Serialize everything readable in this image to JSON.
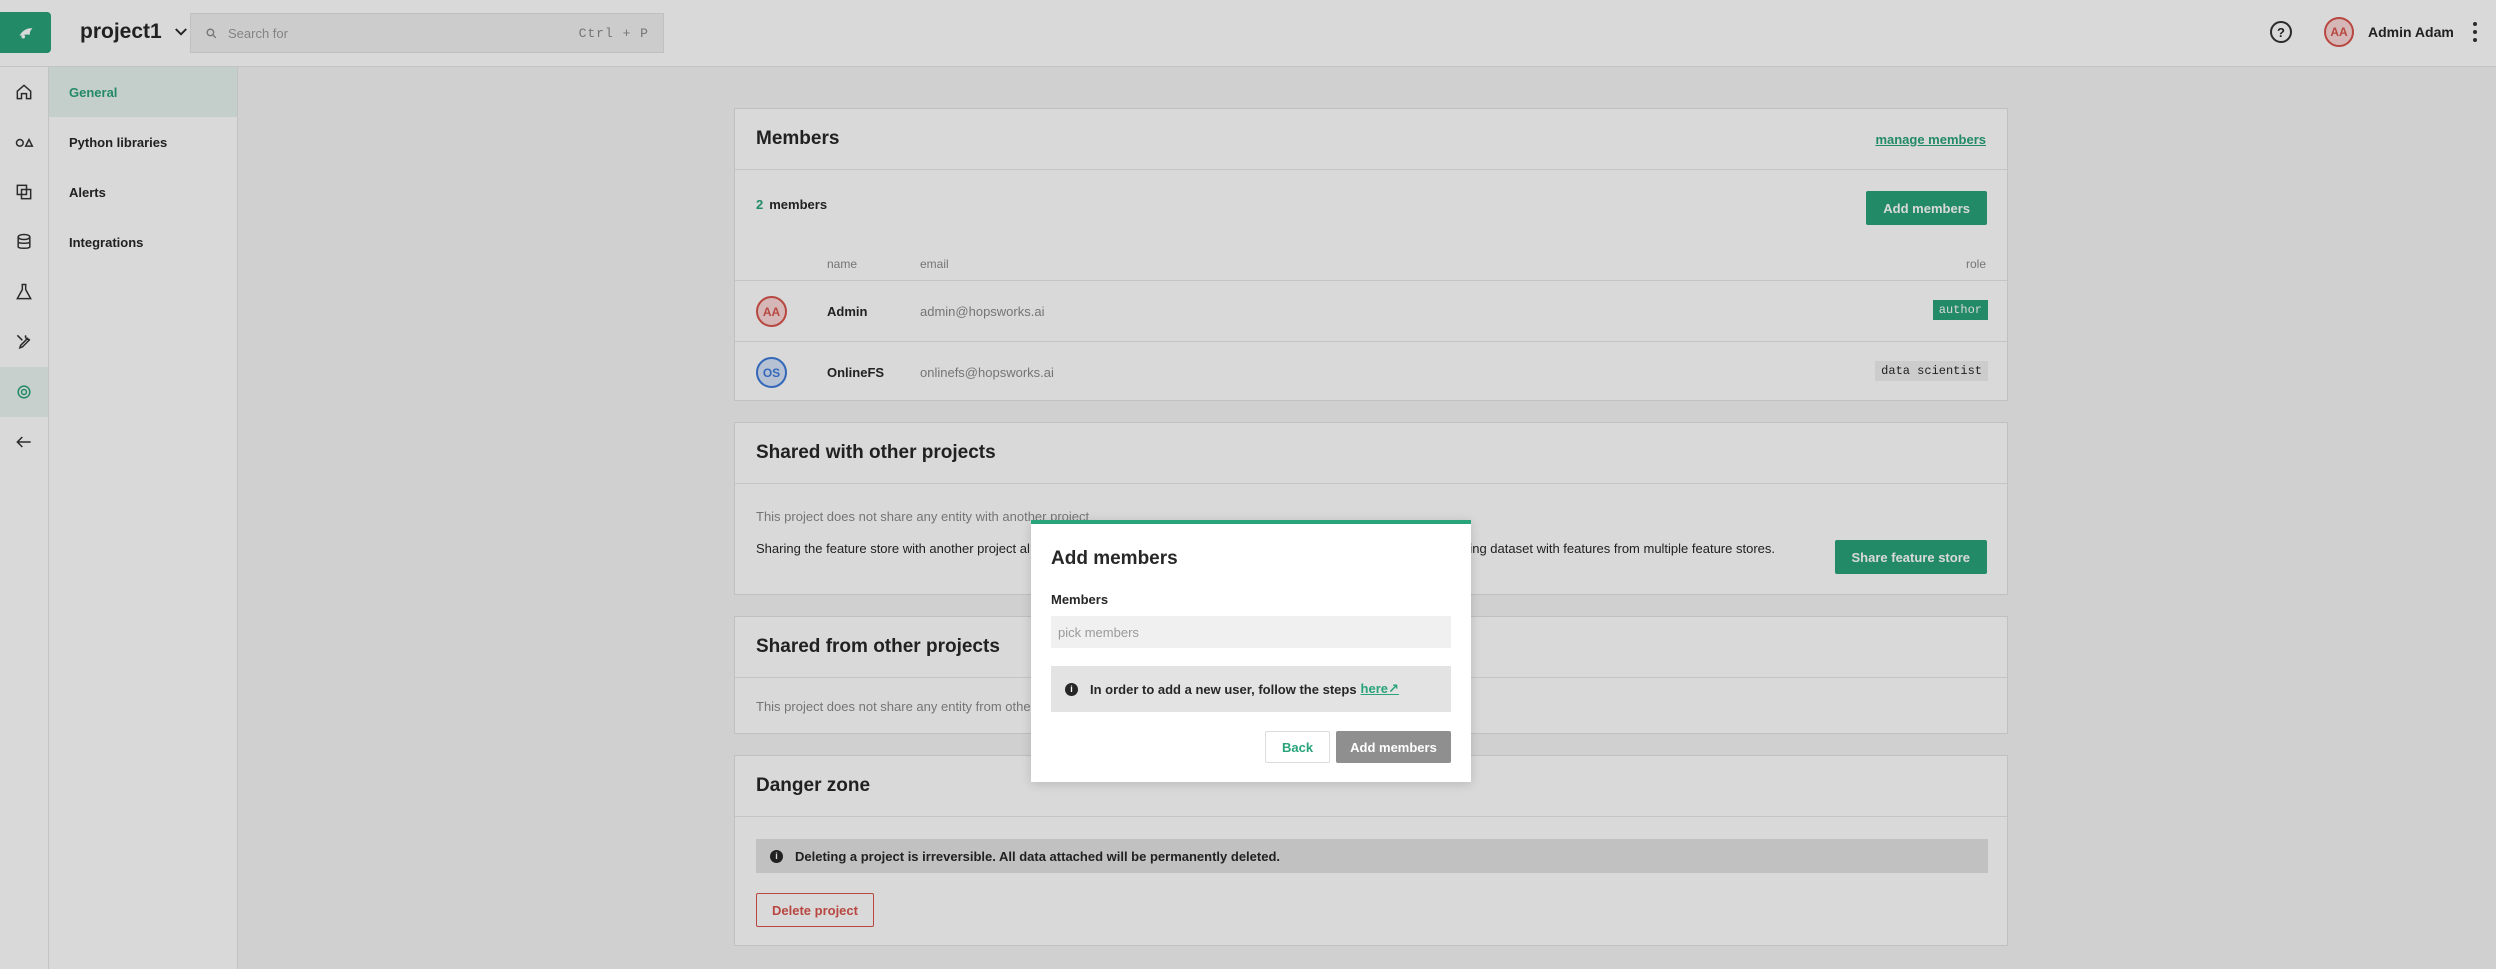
{
  "header": {
    "project_name": "project1",
    "search_placeholder": "Search for",
    "search_shortcut": "Ctrl + P",
    "help_glyph": "?",
    "user_initials": "AA",
    "user_name": "Admin Adam"
  },
  "rail": {
    "items": [
      "home-icon",
      "feature-store-icon",
      "jobs-icon",
      "datasets-icon",
      "experiments-icon",
      "tools-icon",
      "settings-icon",
      "back-icon"
    ],
    "active_index": 6
  },
  "sidebar": {
    "items": [
      {
        "label": "General",
        "active": true
      },
      {
        "label": "Python libraries",
        "active": false
      },
      {
        "label": "Alerts",
        "active": false
      },
      {
        "label": "Integrations",
        "active": false
      }
    ]
  },
  "members": {
    "title": "Members",
    "manage_link": "manage members",
    "count": "2",
    "count_label": "members",
    "add_button": "Add members",
    "columns": {
      "name": "name",
      "email": "email",
      "role": "role"
    },
    "rows": [
      {
        "initials": "AA",
        "name": "Admin",
        "email": "admin@hopsworks.ai",
        "role": "author"
      },
      {
        "initials": "OS",
        "name": "OnlineFS",
        "email": "onlinefs@hopsworks.ai",
        "role": "data scientist"
      }
    ]
  },
  "shared_with": {
    "title": "Shared with other projects",
    "empty_text": "This project does not share any entity with another project",
    "description_left": "Sharing the feature store with another project al",
    "description_right": "aining dataset with features from multiple feature stores.",
    "share_button": "Share feature store"
  },
  "shared_from": {
    "title": "Shared from other projects",
    "empty_text": "This project does not share any entity from othe"
  },
  "danger": {
    "title": "Danger zone",
    "warning": "Deleting a project is irreversible. All data attached will be permanently deleted.",
    "delete_button": "Delete project"
  },
  "modal": {
    "title": "Add members",
    "field_label": "Members",
    "field_placeholder": "pick members",
    "note_text": "In order to add a new user, follow the steps",
    "note_link": "here↗",
    "back_button": "Back",
    "submit_button": "Add members"
  },
  "colors": {
    "accent": "#29a37a",
    "danger": "#d9544d",
    "avatar_blue": "#3d7bd9"
  }
}
